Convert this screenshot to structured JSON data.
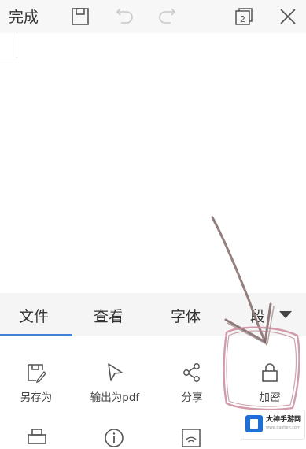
{
  "toolbar": {
    "done_label": "完成",
    "icons": [
      "save-icon",
      "undo-icon",
      "redo-icon",
      "multiwindow-icon",
      "close-icon"
    ],
    "window_count": "2"
  },
  "tabs": [
    {
      "label": "文件",
      "active": true
    },
    {
      "label": "查看",
      "active": false
    },
    {
      "label": "字体",
      "active": false
    },
    {
      "label": "段",
      "active": false
    }
  ],
  "tools": [
    {
      "label": "另存为",
      "icon": "save-as-icon"
    },
    {
      "label": "输出为pdf",
      "icon": "export-pdf-icon"
    },
    {
      "label": "分享",
      "icon": "share-icon"
    },
    {
      "label": "加密",
      "icon": "lock-icon"
    }
  ],
  "tools_row2_icons": [
    "print-icon",
    "info-icon",
    "wifi-icon"
  ],
  "watermark": {
    "title": "大神手游网",
    "subtitle": "www.dashen.com"
  },
  "colors": {
    "accent": "#3f7fd8",
    "annotation": "#8a6f6f",
    "circle": "#c98a9a"
  }
}
